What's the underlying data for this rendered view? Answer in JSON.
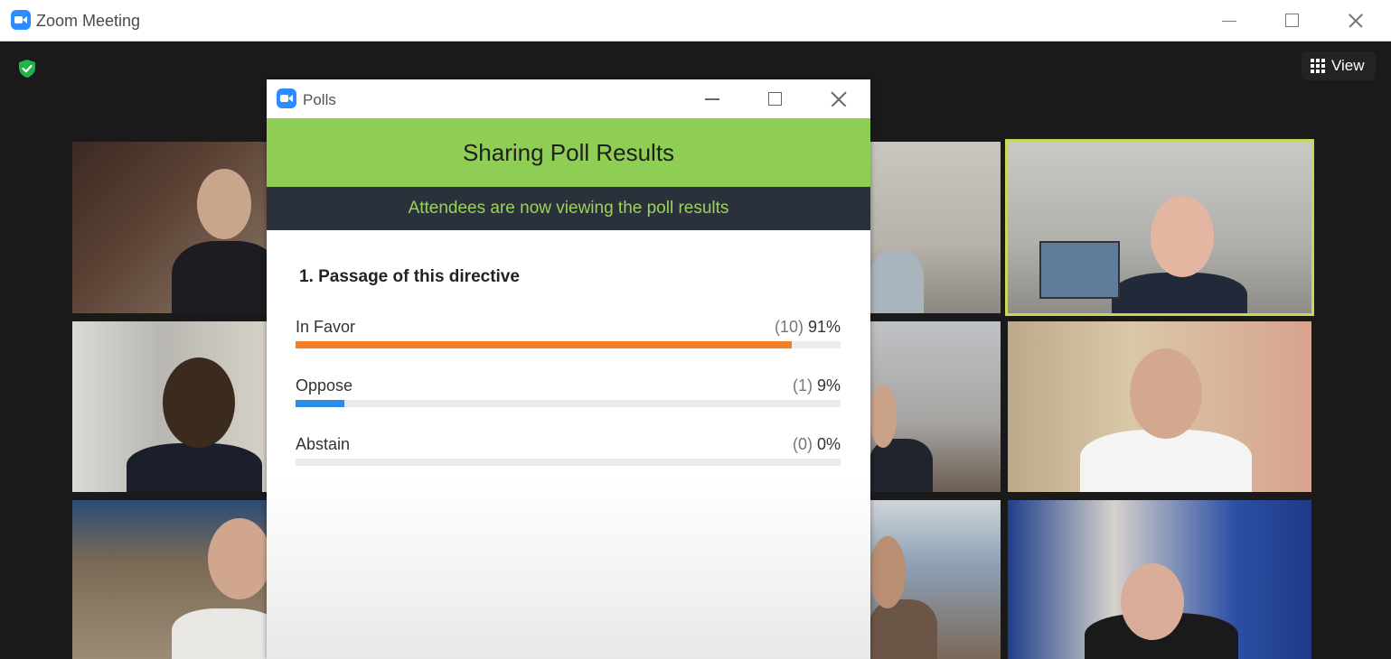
{
  "window": {
    "title": "Zoom Meeting"
  },
  "view_button": {
    "label": "View"
  },
  "polls": {
    "title": "Polls",
    "banner": "Sharing Poll Results",
    "subbanner": "Attendees are now viewing the poll results",
    "question": "1. Passage of this directive",
    "options": [
      {
        "label": "In Favor",
        "count": "(10)",
        "percent": "91%",
        "value": 0.91,
        "color": "#f57d22"
      },
      {
        "label": "Oppose",
        "count": "(1)",
        "percent": "9%",
        "value": 0.09,
        "color": "#2d8ce6"
      },
      {
        "label": "Abstain",
        "count": "(0)",
        "percent": "0%",
        "value": 0.0,
        "color": "#2d8ce6"
      }
    ]
  },
  "colors": {
    "banner_green": "#8fce55",
    "subbanner_dark": "#2b313a",
    "active_speaker_border": "#c9d65a",
    "zoom_blue": "#2d8cff"
  }
}
